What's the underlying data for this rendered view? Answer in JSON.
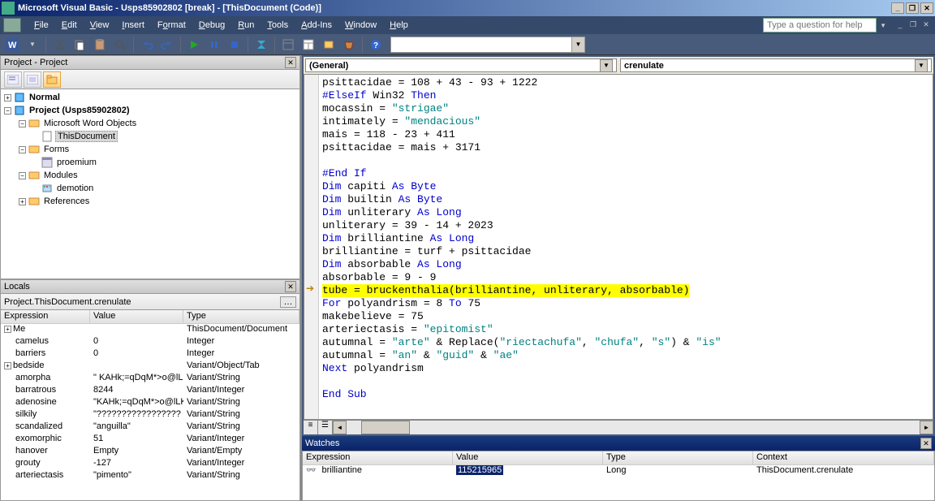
{
  "title": "Microsoft Visual Basic - Usps85902802 [break] - [ThisDocument (Code)]",
  "menu": {
    "file": "File",
    "edit": "Edit",
    "view": "View",
    "insert": "Insert",
    "format": "Format",
    "debug": "Debug",
    "run": "Run",
    "tools": "Tools",
    "addins": "Add-Ins",
    "window": "Window",
    "help": "Help"
  },
  "help_placeholder": "Type a question for help",
  "project": {
    "title": "Project - Project",
    "nodes": {
      "normal": "Normal",
      "project": "Project (Usps85902802)",
      "mwo": "Microsoft Word Objects",
      "thisdoc": "ThisDocument",
      "forms": "Forms",
      "proemium": "proemium",
      "modules": "Modules",
      "demotion": "demotion",
      "refs": "References"
    }
  },
  "locals": {
    "title": "Locals",
    "path": "Project.ThisDocument.crenulate",
    "headers": {
      "expr": "Expression",
      "val": "Value",
      "type": "Type"
    },
    "rows": [
      {
        "expr": "Me",
        "val": "",
        "type": "ThisDocument/Document",
        "toggle": "+",
        "indent": 0
      },
      {
        "expr": "camelus",
        "val": "0",
        "type": "Integer",
        "indent": 1
      },
      {
        "expr": "barriers",
        "val": "0",
        "type": "Integer",
        "indent": 1
      },
      {
        "expr": "bedside",
        "val": "",
        "type": "Variant/Object/Tab",
        "toggle": "+",
        "indent": 0
      },
      {
        "expr": "amorpha",
        "val": "\"   KAHk;=qDqM*>o@lL",
        "type": "Variant/String",
        "indent": 1
      },
      {
        "expr": "barratrous",
        "val": "8244",
        "type": "Variant/Integer",
        "indent": 1
      },
      {
        "expr": "adenosine",
        "val": "\"KAHk;=qDqM*>o@lLK.",
        "type": "Variant/String",
        "indent": 1
      },
      {
        "expr": "silkily",
        "val": "\"?????????????????",
        "type": "Variant/String",
        "indent": 1
      },
      {
        "expr": "scandalized",
        "val": "\"anguilla\"",
        "type": "Variant/String",
        "indent": 1
      },
      {
        "expr": "exomorphic",
        "val": "51",
        "type": "Variant/Integer",
        "indent": 1
      },
      {
        "expr": "hanover",
        "val": "Empty",
        "type": "Variant/Empty",
        "indent": 1
      },
      {
        "expr": "grouty",
        "val": "-127",
        "type": "Variant/Integer",
        "indent": 1
      },
      {
        "expr": "arteriectasis",
        "val": "\"pimento\"",
        "type": "Variant/String",
        "indent": 1
      }
    ]
  },
  "code": {
    "dd_left": "(General)",
    "dd_right": "crenulate",
    "lines": [
      {
        "t": "psittacidae = 108 + 43 - 93 + 1222"
      },
      {
        "pre": "#ElseIf",
        "mid": " Win32 ",
        "post": "Then",
        "kind": "cond"
      },
      {
        "t": "mocassin = \"strigae\"",
        "str": true
      },
      {
        "t": "intimately = \"mendacious\"",
        "str": true
      },
      {
        "t": "mais = 118 - 23 + 411"
      },
      {
        "t": "psittacidae = mais + 3171"
      },
      {
        "t": ""
      },
      {
        "t": "#End If",
        "kind": "cond"
      },
      {
        "pre": "Dim",
        "mid": " capiti ",
        "post": "As Byte"
      },
      {
        "pre": "Dim",
        "mid": " builtin ",
        "post": "As Byte"
      },
      {
        "pre": "Dim",
        "mid": " unliterary ",
        "post": "As Long"
      },
      {
        "t": "unliterary = 39 - 14 + 2023"
      },
      {
        "pre": "Dim",
        "mid": " brilliantine ",
        "post": "As Long"
      },
      {
        "t": "brilliantine = turf + psittacidae"
      },
      {
        "pre": "Dim",
        "mid": " absorbable ",
        "post": "As Long"
      },
      {
        "t": "absorbable = 9 - 9"
      },
      {
        "t": "tube = bruckenthalia(brilliantine, unliterary, absorbable)",
        "hl": true
      },
      {
        "pre": "For",
        "mid": " polyandrism = 8 ",
        "post": "To",
        "tail": " 75"
      },
      {
        "t": "makebelieve = 75"
      },
      {
        "t": "arteriectasis = \"epitomist\"",
        "str": true
      },
      {
        "raw": "autumnal = \"arte\" & Replace(\"riectachufa\", \"chufa\", \"s\") & \"is\""
      },
      {
        "raw": "autumnal = \"an\" & \"guid\" & \"ae\""
      },
      {
        "pre": "Next",
        "mid": " polyandrism"
      },
      {
        "t": ""
      },
      {
        "pre": "End Sub"
      }
    ]
  },
  "watches": {
    "title": "Watches",
    "headers": {
      "expr": "Expression",
      "val": "Value",
      "type": "Type",
      "ctx": "Context"
    },
    "row": {
      "expr": "brilliantine",
      "val": "115215965",
      "type": "Long",
      "ctx": "ThisDocument.crenulate"
    }
  }
}
